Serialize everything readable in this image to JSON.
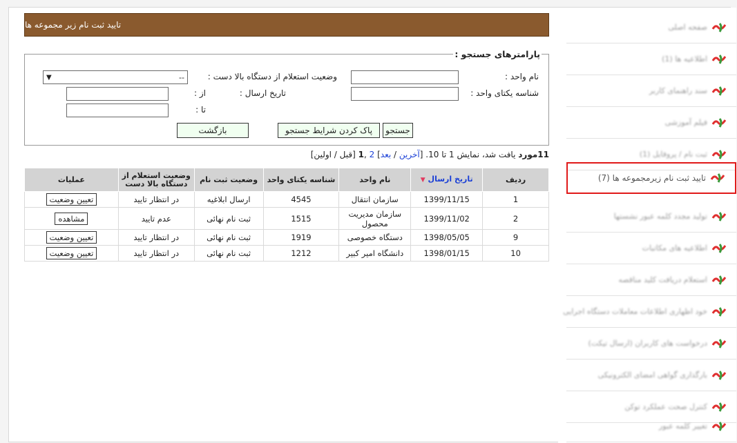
{
  "sidebar": {
    "items": [
      {
        "label": "صفحه اصلی",
        "active": false
      },
      {
        "label": "اطلاعیه ها (1)",
        "active": false
      },
      {
        "label": "سند راهنمای کاربر",
        "active": false
      },
      {
        "label": "فیلم آموزشی",
        "active": false
      },
      {
        "label": "ثبت نام / پروفایل (1)",
        "active": false
      },
      {
        "label": "تایید ثبت نام زیرمجموعه ها  (7)",
        "active": true
      },
      {
        "label": "تولید مجدد کلمه عبور نشستها",
        "active": false
      },
      {
        "label": "اطلاعیه های مکاتبات",
        "active": false
      },
      {
        "label": "استعلام دریافت کلید مناقصه",
        "active": false
      },
      {
        "label": "خود اظهاری اطلاعات معاملات دستگاه اجرایی",
        "active": false
      },
      {
        "label": "درخواست های کاربران (ارسال تیکت)",
        "active": false
      },
      {
        "label": "بارگذاری گواهی امضای الکترونیکی",
        "active": false
      },
      {
        "label": "کنترل صحت عملکرد توکن",
        "active": false
      },
      {
        "label": "تغییر کلمه عبور",
        "active": false
      }
    ]
  },
  "main": {
    "title": "تایید ثبت نام زیر مجموعه ها",
    "search": {
      "legend": "پارامترهای جستجو :",
      "unit_name_label": "نام واحد :",
      "unit_name_value": "",
      "inquiry_status_label": "وضعیت استعلام از دستگاه بالا دست :",
      "inquiry_status_value": "--",
      "unit_id_label": "شناسه یکتای واحد :",
      "unit_id_value": "",
      "send_date_label": "تاریخ ارسال :",
      "from_label": "از :",
      "from_value": "",
      "to_label": "تا :",
      "to_value": "",
      "search_button": "جستجو",
      "clear_button": "پاک کردن شرایط جستجو",
      "back_button": "بازگشت"
    },
    "results": {
      "count": "11",
      "count_word": "مورد",
      "summary": "یافت شد، نمایش 1 تا 10.",
      "open_bracket": "[",
      "last_link": "آخرین",
      "slash1": "/",
      "next_link": "بعد",
      "close_bracket": "]",
      "page2_link": "2",
      "comma": ",",
      "page1": "1",
      "prev_first": "[قبل / اولین]"
    },
    "table": {
      "headers": {
        "row": "ردیف",
        "send_date": "تاریخ ارسال",
        "unit_name": "نام واحد",
        "unit_id": "شناسه یکتای واحد",
        "reg_status": "وضعیت ثبت نام",
        "inquiry_status": "وضعیت استعلام از دستگاه بالا دست",
        "operations": "عملیات"
      },
      "rows": [
        {
          "row": "1",
          "send_date": "1399/11/15",
          "unit_name": "سازمان انتقال",
          "unit_id": "4545",
          "reg_status": "ارسال ابلاغیه",
          "inquiry_status": "در انتظار تایید",
          "action": "تعیین وضعیت"
        },
        {
          "row": "2",
          "send_date": "1399/11/02",
          "unit_name": "سازمان مدیریت محصول",
          "unit_id": "1515",
          "reg_status": "ثبت نام نهائی",
          "inquiry_status": "عدم تایید",
          "action": "مشاهده"
        },
        {
          "row": "9",
          "send_date": "1398/05/05",
          "unit_name": "دستگاه خصوصی",
          "unit_id": "1919",
          "reg_status": "ثبت نام نهائی",
          "inquiry_status": "در انتظار تایید",
          "action": "تعیین وضعیت"
        },
        {
          "row": "10",
          "send_date": "1398/01/15",
          "unit_name": "دانشگاه امیر کبیر",
          "unit_id": "1212",
          "reg_status": "ثبت نام نهائی",
          "inquiry_status": "در انتظار تایید",
          "action": "تعیین وضعیت"
        }
      ]
    }
  },
  "colors": {
    "title_bar": "#8a5a2e",
    "active_border": "#e01818",
    "link": "#1a3fd6",
    "header_bg": "#d3d3d3",
    "button_bg": "#f0fff0"
  }
}
